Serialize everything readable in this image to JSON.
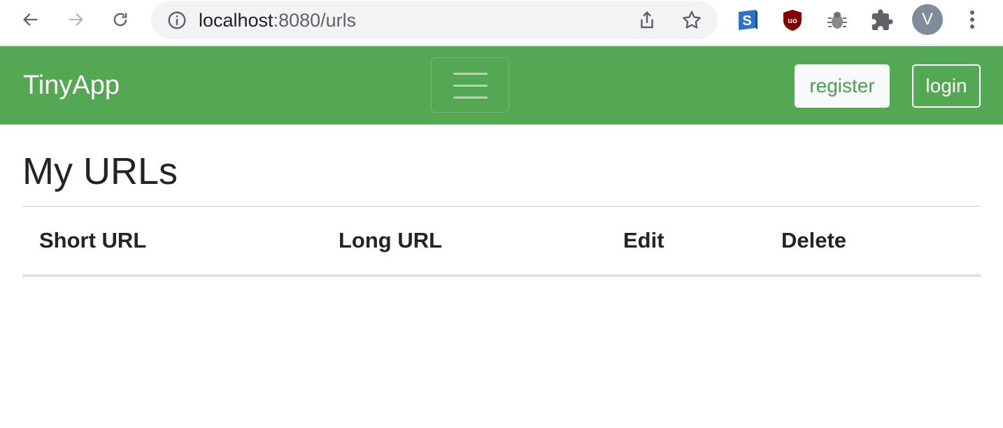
{
  "browser": {
    "url_host": "localhost",
    "url_path": ":8080/urls",
    "profile_initial": "V",
    "extensions": [
      "s-extension-icon",
      "ublock-icon",
      "bug-icon",
      "puzzle-icon"
    ]
  },
  "navbar": {
    "brand": "TinyApp",
    "register_label": "register",
    "login_label": "login",
    "bg_color": "#54a854"
  },
  "main": {
    "title": "My URLs",
    "table": {
      "columns": [
        "Short URL",
        "Long URL",
        "Edit",
        "Delete"
      ],
      "rows": []
    }
  }
}
